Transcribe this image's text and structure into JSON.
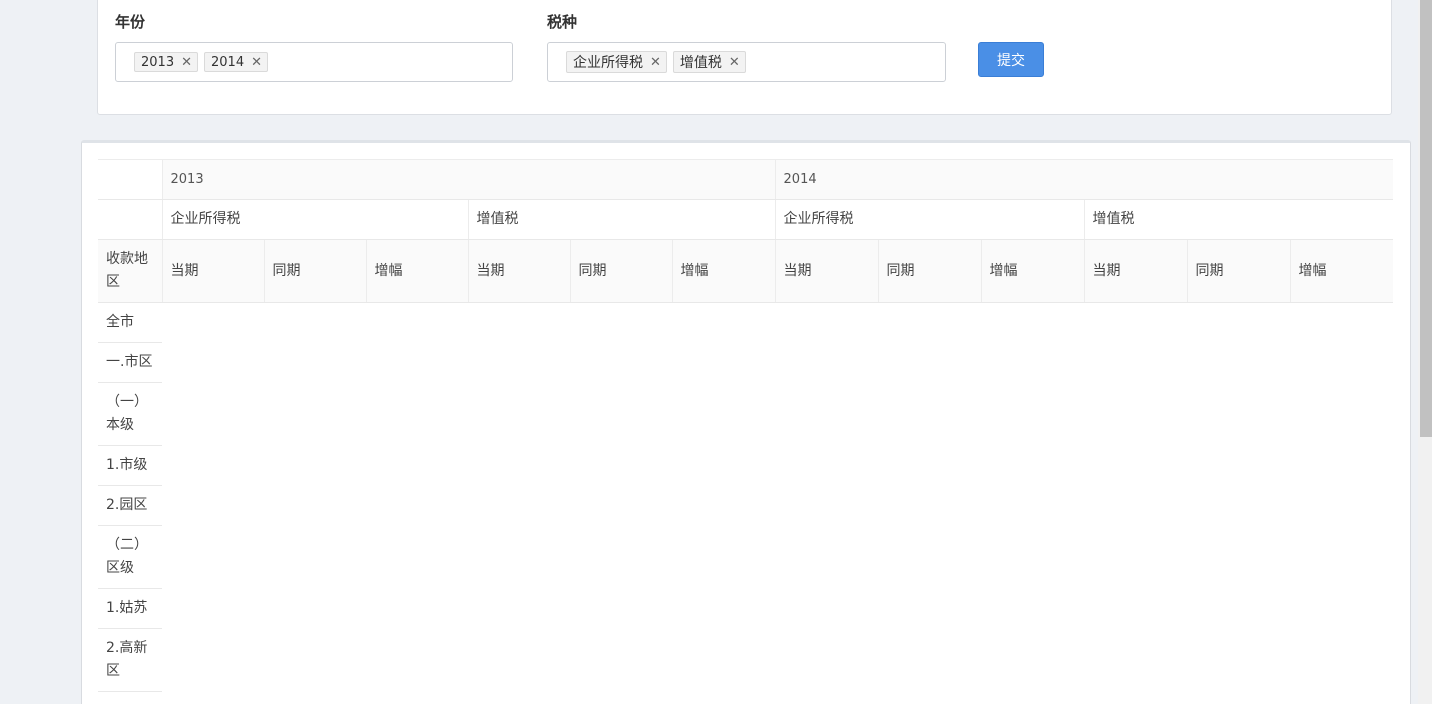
{
  "filters": {
    "year_label": "年份",
    "years": [
      "2013",
      "2014"
    ],
    "tax_label": "税种",
    "taxes": [
      "企业所得税",
      "增值税"
    ],
    "remove_glyph": "✕",
    "submit_label": "提交"
  },
  "table": {
    "years": [
      "2013",
      "2014"
    ],
    "tax_types": [
      "企业所得税",
      "增值税",
      "企业所得税",
      "增值税"
    ],
    "region_header": "收款地区",
    "metrics": [
      "当期",
      "同期",
      "增幅"
    ],
    "rows": [
      "全市",
      "一.市区",
      "（一）本级",
      "1.市级",
      "2.园区",
      "（二）区级",
      "1.姑苏",
      "2.高新区"
    ]
  }
}
